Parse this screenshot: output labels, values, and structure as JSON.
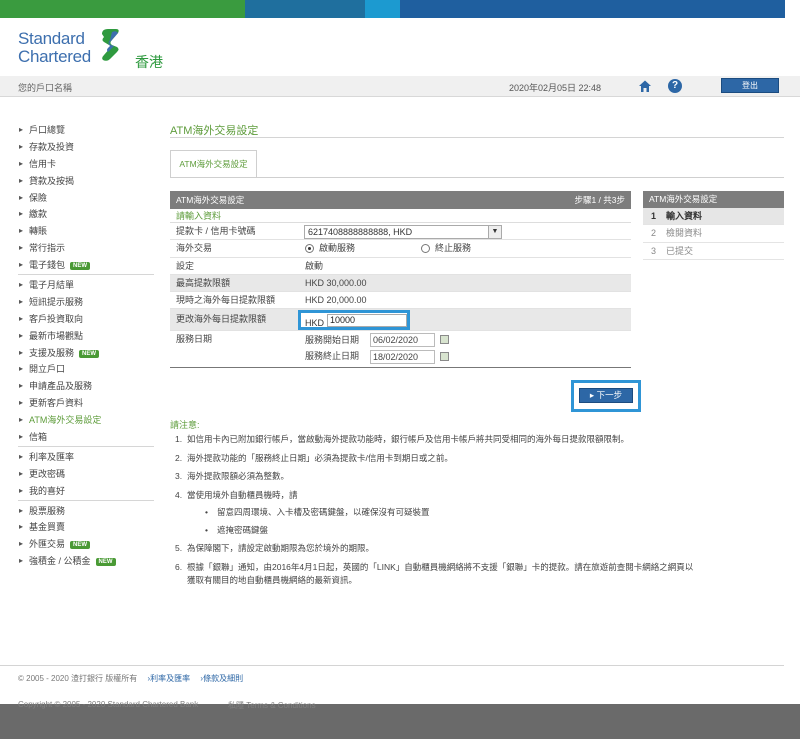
{
  "brand": {
    "name_line1": "Standard",
    "name_line2": "Chartered",
    "region": "香港"
  },
  "colors": {
    "brand_blue": "#2d67a6",
    "brand_green": "#5e9c3b",
    "highlight_blue": "#2f95d6"
  },
  "header": {
    "account_name": "您的戶口名稱",
    "datetime": "2020年02月05日 22:48",
    "logout_label": "登出",
    "home_icon": "home-icon",
    "help_icon": "help-icon"
  },
  "sidebar": {
    "groups": [
      [
        {
          "label": "戶口總覽"
        },
        {
          "label": "存款及投資"
        },
        {
          "label": "信用卡"
        },
        {
          "label": "貸款及按揭"
        },
        {
          "label": "保險"
        },
        {
          "label": "繳款"
        },
        {
          "label": "轉賬"
        },
        {
          "label": "常行指示"
        },
        {
          "label": "電子錢包",
          "badge": "NEW"
        }
      ],
      [
        {
          "label": "電子月結單"
        },
        {
          "label": "短訊提示服務"
        },
        {
          "label": "客戶投資取向"
        },
        {
          "label": "最新市場觀點"
        },
        {
          "label": "支援及服務",
          "badge": "NEW"
        },
        {
          "label": "開立戶口"
        },
        {
          "label": "申請產品及服務"
        },
        {
          "label": "更新客戶資料"
        },
        {
          "label": "ATM海外交易設定",
          "active": true
        },
        {
          "label": "信箱"
        }
      ],
      [
        {
          "label": "利率及匯率"
        },
        {
          "label": "更改密碼"
        },
        {
          "label": "我的喜好"
        }
      ],
      [
        {
          "label": "股票服務"
        },
        {
          "label": "基金買賣"
        },
        {
          "label": "外匯交易",
          "badge": "NEW"
        },
        {
          "label": "強積金 / 公積金",
          "badge": "NEW"
        }
      ]
    ]
  },
  "main": {
    "title": "ATM海外交易設定",
    "tab_label": "ATM海外交易設定",
    "form": {
      "header": "ATM海外交易設定",
      "step_text": "步驟1 / 共3步",
      "subheader": "請輸入資料",
      "card_label": "提款卡 / 信用卡號碼",
      "card_value": "6217408888888888, HKD",
      "overseas_label": "海外交易",
      "radio_on_label": "啟動服務",
      "radio_off_label": "終止服務",
      "setting_label": "設定",
      "setting_value": "啟動",
      "max_label": "最高提款限額",
      "max_value": "HKD 30,000.00",
      "current_label": "現時之海外每日提款限額",
      "current_value": "HKD 20,000.00",
      "change_label": "更改海外每日提款限額",
      "change_currency": "HKD",
      "change_value": "10000",
      "period_label": "服務日期",
      "start_label": "服務開始日期",
      "start_value": "06/02/2020",
      "end_label": "服務終止日期",
      "end_value": "18/02/2020"
    },
    "next_label": "下一步",
    "notes_title": "請注意:",
    "notes": [
      "如信用卡內已附加銀行帳戶，當啟動海外提款功能時，銀行帳戶及信用卡帳戶將共同受相同的海外每日提款限額限制。",
      "海外提款功能的「服務終止日期」必須為提款卡/信用卡到期日或之前。",
      "海外提款限額必須為整數。",
      "當使用境外自動櫃員機時，請",
      "為保障閣下，請設定啟動期限為您於境外的期限。",
      "根據「銀聯」通知，由2016年4月1日起，英國的「LINK」自動櫃員機網絡將不支援「銀聯」卡的提款。請在旅遊前查閱卡網絡之網頁以獲取有關目的地自動櫃員機網絡的最新資訊。"
    ],
    "note4_subs": [
      "留意四周環境、入卡槽及密碼鍵盤，以確保沒有可疑裝置",
      "遮掩密碼鍵盤"
    ]
  },
  "steps_panel": {
    "header": "ATM海外交易設定",
    "items": [
      {
        "num": "1",
        "label": "輸入資料"
      },
      {
        "num": "2",
        "label": "檢閱資料"
      },
      {
        "num": "3",
        "label": "已提交"
      }
    ]
  },
  "footer": {
    "copyright": "© 2005 - 2020 渣打銀行 版權所有",
    "links": [
      "利率及匯率",
      "條款及細則"
    ],
    "copyright_en": "Copyright © 2005 - 2020 Standard Chartered Bank",
    "links_en": "私隱  Terms & Conditions"
  }
}
